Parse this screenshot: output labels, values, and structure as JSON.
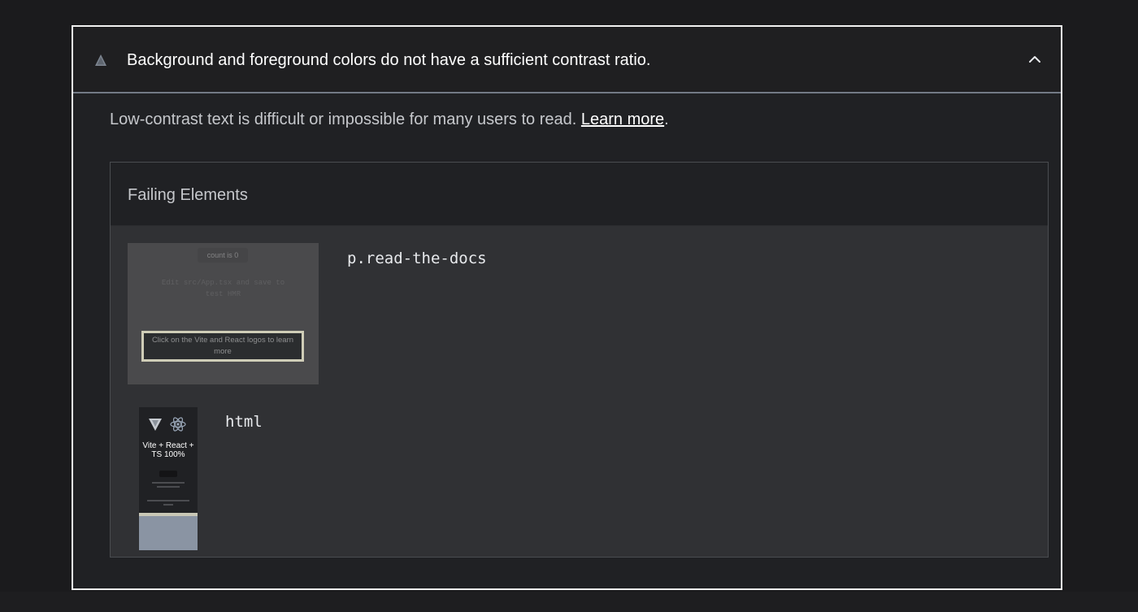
{
  "audit": {
    "title": "Background and foreground colors do not have a sufficient contrast ratio.",
    "description_text": "Low-contrast text is difficult or impossible for many users to read. ",
    "learn_more_label": "Learn more",
    "description_end": "."
  },
  "failing_elements": {
    "header": "Failing Elements",
    "items": [
      {
        "selector": "p.read-the-docs",
        "thumbnail": {
          "count_label": "count is 0",
          "edit_text": "Edit src/App.tsx and save to test HMR",
          "highlight_text": "Click on the Vite and React logos to learn more"
        }
      },
      {
        "selector": "html",
        "thumbnail": {
          "title": "Vite + React + TS 100%"
        }
      }
    ]
  },
  "colors": {
    "background": "#1b1b1d",
    "card_border": "#f1f1f1",
    "table_body": "#303134",
    "warning_icon": "#7d8590"
  },
  "icons": {
    "warning": "warning-triangle-icon",
    "collapse": "chevron-up-icon"
  }
}
